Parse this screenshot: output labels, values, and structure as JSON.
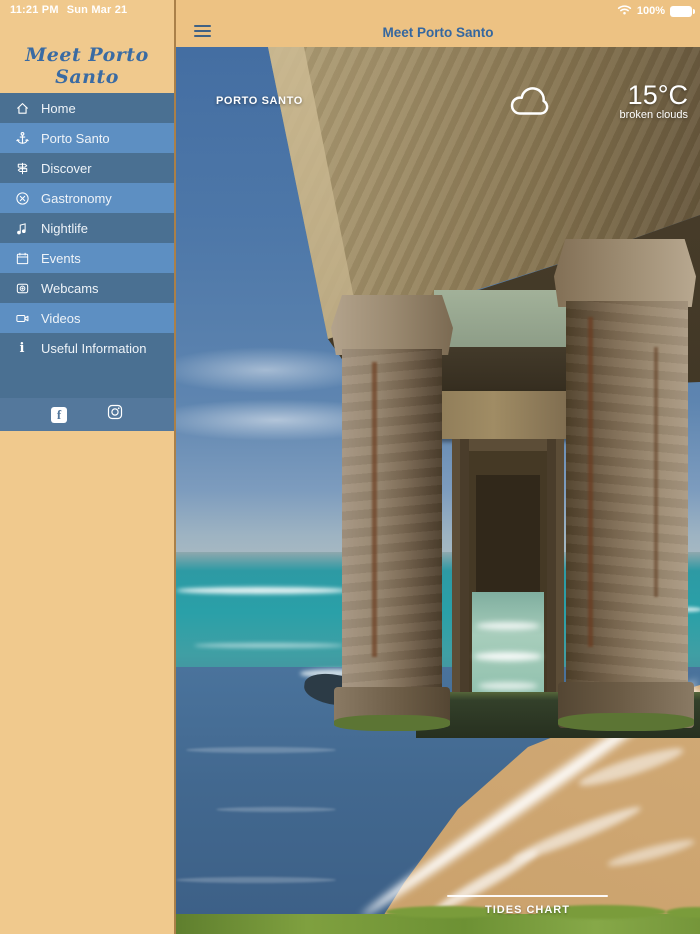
{
  "status_bar": {
    "time": "11:21 PM",
    "date": "Sun Mar 21",
    "battery": "100%"
  },
  "sidebar": {
    "logo": "Meet Porto Santo",
    "items": [
      {
        "label": "Home",
        "icon": "home-icon"
      },
      {
        "label": "Porto Santo",
        "icon": "anchor-icon"
      },
      {
        "label": "Discover",
        "icon": "signpost-icon"
      },
      {
        "label": "Gastronomy",
        "icon": "restaurant-icon"
      },
      {
        "label": "Nightlife",
        "icon": "music-notes-icon"
      },
      {
        "label": "Events",
        "icon": "calendar-icon"
      },
      {
        "label": "Webcams",
        "icon": "webcam-icon"
      },
      {
        "label": "Videos",
        "icon": "video-camera-icon"
      },
      {
        "label": "Useful Information",
        "icon": "info-icon"
      }
    ],
    "social": [
      "facebook",
      "instagram"
    ]
  },
  "header": {
    "title": "Meet Porto Santo"
  },
  "weather_overlay": {
    "location": "PORTO SANTO",
    "temperature": "15°C",
    "conditions": "broken clouds",
    "icon": "cloud-icon"
  },
  "tides": {
    "label": "TIDES CHART"
  },
  "colors": {
    "sidebar_bg": "#f0c98d",
    "header_bg": "#edc283",
    "menu_dark": "#4a7092",
    "menu_light": "#5d8fc2",
    "social_bar": "#54789c",
    "title_blue": "#35679f",
    "logo_blue": "#3a6ba3"
  }
}
